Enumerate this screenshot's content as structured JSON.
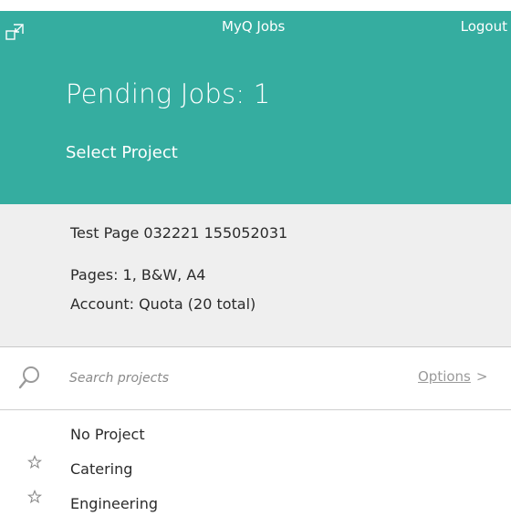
{
  "header": {
    "app_title": "MyQ Jobs",
    "logout_label": "Logout",
    "pending_jobs": "Pending Jobs: 1",
    "select_project": "Select Project",
    "background_color": "#35ada0"
  },
  "job": {
    "name": "Test Page 032221 155052031",
    "pages": "Pages: 1, B&W, A4",
    "account": "Account: Quota (20 total)"
  },
  "search": {
    "placeholder": "Search projects",
    "options_label": "Options",
    "options_arrow": ">"
  },
  "projects": [
    {
      "label": "No Project",
      "starred": false,
      "icon": ""
    },
    {
      "label": "Catering",
      "starred": false,
      "icon": "star-outline-icon"
    },
    {
      "label": "Engineering",
      "starred": false,
      "icon": "star-outline-icon"
    }
  ]
}
